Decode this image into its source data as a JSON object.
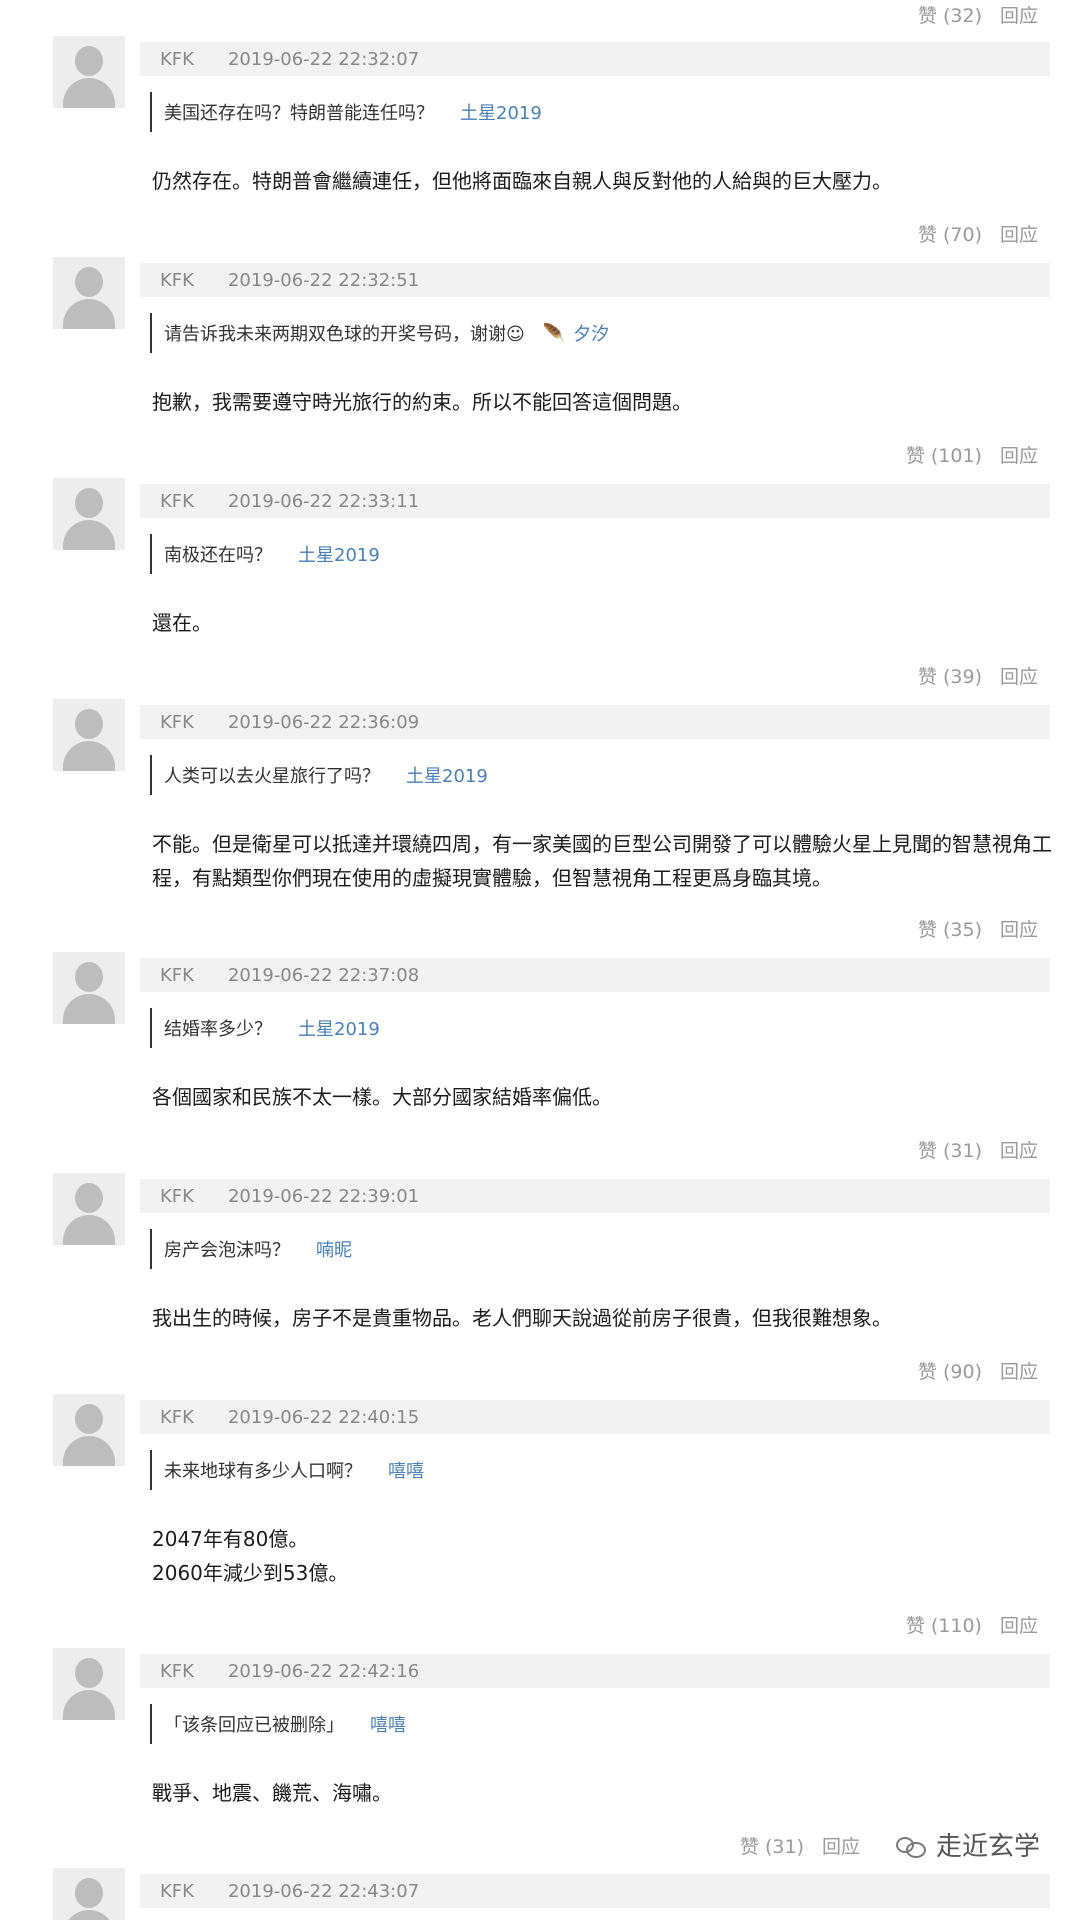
{
  "top_actions": {
    "like": "赞 (32)",
    "reply": "回应"
  },
  "comments": [
    {
      "user": "KFK",
      "time": "2019-06-22 22:32:07",
      "quote": "美国还存在吗？特朗普能连任吗？",
      "quote_author": "土星2019",
      "reply": "仍然存在。特朗普會繼續連任，但他將面臨來自親人與反對他的人給與的巨大壓力。",
      "like": "赞 (70)",
      "reply_btn": "回应"
    },
    {
      "user": "KFK",
      "time": "2019-06-22 22:32:51",
      "quote": "请告诉我未来两期双色球的开奖号码，谢谢☺",
      "quote_author": "夕汐",
      "reply": "抱歉，我需要遵守時光旅行的約束。所以不能回答這個問題。",
      "like": "赞 (101)",
      "reply_btn": "回应"
    },
    {
      "user": "KFK",
      "time": "2019-06-22 22:33:11",
      "quote": "南极还在吗？",
      "quote_author": "土星2019",
      "reply": "還在。",
      "like": "赞 (39)",
      "reply_btn": "回应"
    },
    {
      "user": "KFK",
      "time": "2019-06-22 22:36:09",
      "quote": "人类可以去火星旅行了吗？",
      "quote_author": "土星2019",
      "reply": "不能。但是衛星可以抵達并環繞四周，有一家美國的巨型公司開發了可以體驗火星上見聞的智慧視角工程，有點類型你們現在使用的虛擬現實體驗，但智慧視角工程更爲身臨其境。",
      "like": "赞 (35)",
      "reply_btn": "回应"
    },
    {
      "user": "KFK",
      "time": "2019-06-22 22:37:08",
      "quote": "结婚率多少？",
      "quote_author": "土星2019",
      "reply": "各個國家和民族不太一樣。大部分國家結婚率偏低。",
      "like": "赞 (31)",
      "reply_btn": "回应"
    },
    {
      "user": "KFK",
      "time": "2019-06-22 22:39:01",
      "quote": "房产会泡沫吗？",
      "quote_author": "喃昵",
      "reply": "我出生的時候，房子不是貴重物品。老人們聊天說過從前房子很貴，但我很難想象。",
      "like": "赞 (90)",
      "reply_btn": "回应"
    },
    {
      "user": "KFK",
      "time": "2019-06-22 22:40:15",
      "quote": "未来地球有多少人口啊？",
      "quote_author": "嘻嘻",
      "reply_lines": [
        "2047年有80億。",
        "2060年減少到53億。"
      ],
      "like": "赞 (110)",
      "reply_btn": "回应"
    },
    {
      "user": "KFK",
      "time": "2019-06-22 22:42:16",
      "quote": "「该条回应已被删除」",
      "quote_author": "嘻嘻",
      "reply": "戰爭、地震、饑荒、海嘯。",
      "like": "赞 (31)",
      "reply_btn": "回应"
    },
    {
      "user": "KFK",
      "time": "2019-06-22 22:43:07"
    }
  ],
  "watermark": {
    "text": "走近玄学",
    "icon": "wechat-icon"
  }
}
